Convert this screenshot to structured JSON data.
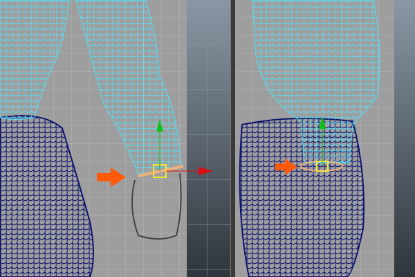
{
  "colors": {
    "viewport_bg": "#9e9e9e",
    "backdrop_top": "#8a97a4",
    "backdrop_bottom": "#2f353c",
    "grid": "#b8b8b8",
    "selected_wire": "#55ddf5",
    "unselected_wire": "#0e1570",
    "joint": "#f2b07a",
    "pivot": "#f5e63a",
    "arrow_annotation": "#ff5a0a",
    "axis_x": "#d81010",
    "axis_y": "#10c010"
  },
  "viewports": [
    {
      "view": "left",
      "icon": "wireframe-arm-model"
    },
    {
      "view": "right",
      "icon": "wireframe-arm-model"
    }
  ]
}
